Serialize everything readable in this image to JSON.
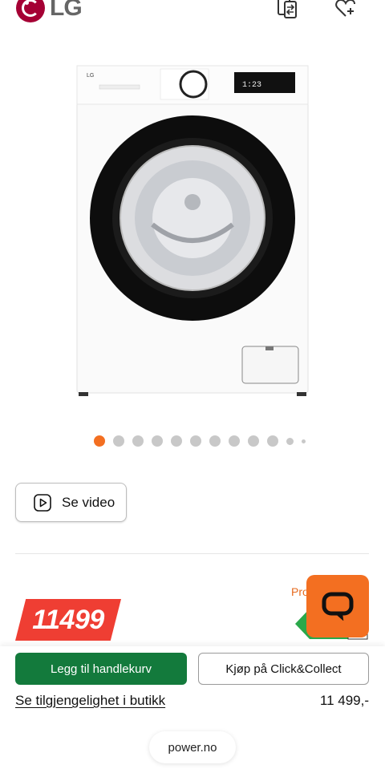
{
  "header": {
    "brand": "LG",
    "compare_icon": "compare-icon",
    "favorite_icon": "heart-plus-icon"
  },
  "colors": {
    "brand_red": "#a50034",
    "accent_orange": "#f36f21",
    "price_red": "#ef3e33",
    "cart_green": "#137a3c"
  },
  "gallery": {
    "image_alt": "LG washing machine front view",
    "dots_count": 12,
    "active_index": 0
  },
  "video": {
    "label": "Se video"
  },
  "price": {
    "value": "11499"
  },
  "promo": {
    "label": "Pro"
  },
  "chat": {
    "icon": "chat-icon"
  },
  "actions": {
    "add_to_cart": "Legg til handlekurv",
    "click_collect": "Kjøp på Click&Collect",
    "availability_link": "Se tilgjengelighet i butikk",
    "price_text": "11 499,-"
  },
  "footer": {
    "site": "power.no"
  }
}
